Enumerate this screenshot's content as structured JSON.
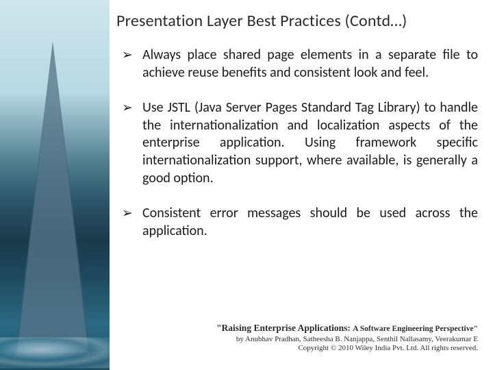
{
  "title": "Presentation Layer Best Practices (Contd…)",
  "bullets": [
    "Always place shared page elements in a separate file to achieve reuse benefits and consistent look and feel.",
    "Use JSTL (Java Server Pages Standard Tag Library) to handle the internationalization and localization aspects of the enterprise application. Using framework specific internationalization support, where available, is generally a good option.",
    "Consistent error messages should be used across the application."
  ],
  "footer": {
    "book_main": "\"Raising Enterprise Applications: ",
    "book_sub": "A Software Engineering Perspective\"",
    "authors": "by Anubhav Pradhan, Satheesha B. Nanjappa, Senthil Nallasamy, Veerakumar E",
    "copyright": "Copyright © 2010 Wiley India Pvt. Ltd. All rights reserved."
  }
}
